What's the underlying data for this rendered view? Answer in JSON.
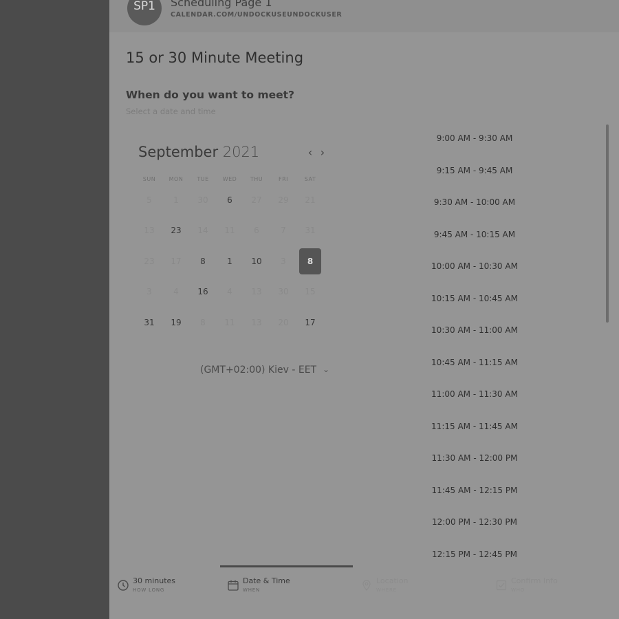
{
  "header": {
    "avatar_initials": "SP1",
    "title": "Scheduling Page 1",
    "url": "CALENDAR.COM/UNDOCKUSEUNDOCKUSER"
  },
  "meeting_title": "15 or 30 Minute Meeting",
  "question": "When do you want to meet?",
  "subtitle": "Select a date and time",
  "calendar": {
    "month": "September",
    "year": "2021",
    "prev_icon": "chevron-left-icon",
    "next_icon": "chevron-right-icon",
    "weekdays": [
      "SUN",
      "MON",
      "TUE",
      "WED",
      "THU",
      "FRI",
      "SAT"
    ],
    "weeks": [
      [
        {
          "d": "5",
          "s": "inactive"
        },
        {
          "d": "1",
          "s": "inactive"
        },
        {
          "d": "30",
          "s": "inactive"
        },
        {
          "d": "6",
          "s": "active"
        },
        {
          "d": "27",
          "s": "inactive"
        },
        {
          "d": "29",
          "s": "inactive"
        },
        {
          "d": "21",
          "s": "inactive"
        }
      ],
      [
        {
          "d": "13",
          "s": "inactive"
        },
        {
          "d": "23",
          "s": "active"
        },
        {
          "d": "14",
          "s": "inactive"
        },
        {
          "d": "11",
          "s": "inactive"
        },
        {
          "d": "6",
          "s": "inactive"
        },
        {
          "d": "7",
          "s": "inactive"
        },
        {
          "d": "31",
          "s": "inactive"
        }
      ],
      [
        {
          "d": "23",
          "s": "inactive"
        },
        {
          "d": "17",
          "s": "inactive"
        },
        {
          "d": "8",
          "s": "active"
        },
        {
          "d": "1",
          "s": "active"
        },
        {
          "d": "10",
          "s": "active"
        },
        {
          "d": "3",
          "s": "inactive"
        },
        {
          "d": "8",
          "s": "selected"
        }
      ],
      [
        {
          "d": "3",
          "s": "inactive"
        },
        {
          "d": "4",
          "s": "inactive"
        },
        {
          "d": "16",
          "s": "active"
        },
        {
          "d": "4",
          "s": "inactive"
        },
        {
          "d": "13",
          "s": "inactive"
        },
        {
          "d": "30",
          "s": "inactive"
        },
        {
          "d": "15",
          "s": "inactive"
        }
      ],
      [
        {
          "d": "31",
          "s": "active"
        },
        {
          "d": "19",
          "s": "active"
        },
        {
          "d": "8",
          "s": "inactive"
        },
        {
          "d": "11",
          "s": "inactive"
        },
        {
          "d": "13",
          "s": "inactive"
        },
        {
          "d": "20",
          "s": "inactive"
        },
        {
          "d": "17",
          "s": "active"
        }
      ]
    ]
  },
  "timezone": {
    "label": "(GMT+02:00) Kiev - EET",
    "icon": "chevron-down-icon"
  },
  "time_slots": [
    "9:00 AM - 9:30 AM",
    "9:15 AM - 9:45 AM",
    "9:30 AM - 10:00 AM",
    "9:45 AM - 10:15 AM",
    "10:00 AM - 10:30 AM",
    "10:15 AM - 10:45 AM",
    "10:30 AM - 11:00 AM",
    "10:45 AM - 11:15 AM",
    "11:00 AM - 11:30 AM",
    "11:15 AM - 11:45 AM",
    "11:30 AM - 12:00 PM",
    "11:45 AM - 12:15 PM",
    "12:00 PM - 12:30 PM",
    "12:15 PM - 12:45 PM"
  ],
  "steps": [
    {
      "label": "30 minutes",
      "sub": "HOW LONG",
      "icon": "clock-icon",
      "state": "on"
    },
    {
      "label": "Date & Time",
      "sub": "WHEN",
      "icon": "calendar-icon",
      "state": "on"
    },
    {
      "label": "Location",
      "sub": "WHERE",
      "icon": "map-pin-icon",
      "state": "off"
    },
    {
      "label": "Confirm Info",
      "sub": "WHO",
      "icon": "checkbox-icon",
      "state": "off"
    }
  ],
  "colors": {
    "page_bg": "#4b4b4b",
    "panel_bg": "#959595",
    "header_bg": "#8f8f8f",
    "selected_day_bg": "#555555"
  }
}
